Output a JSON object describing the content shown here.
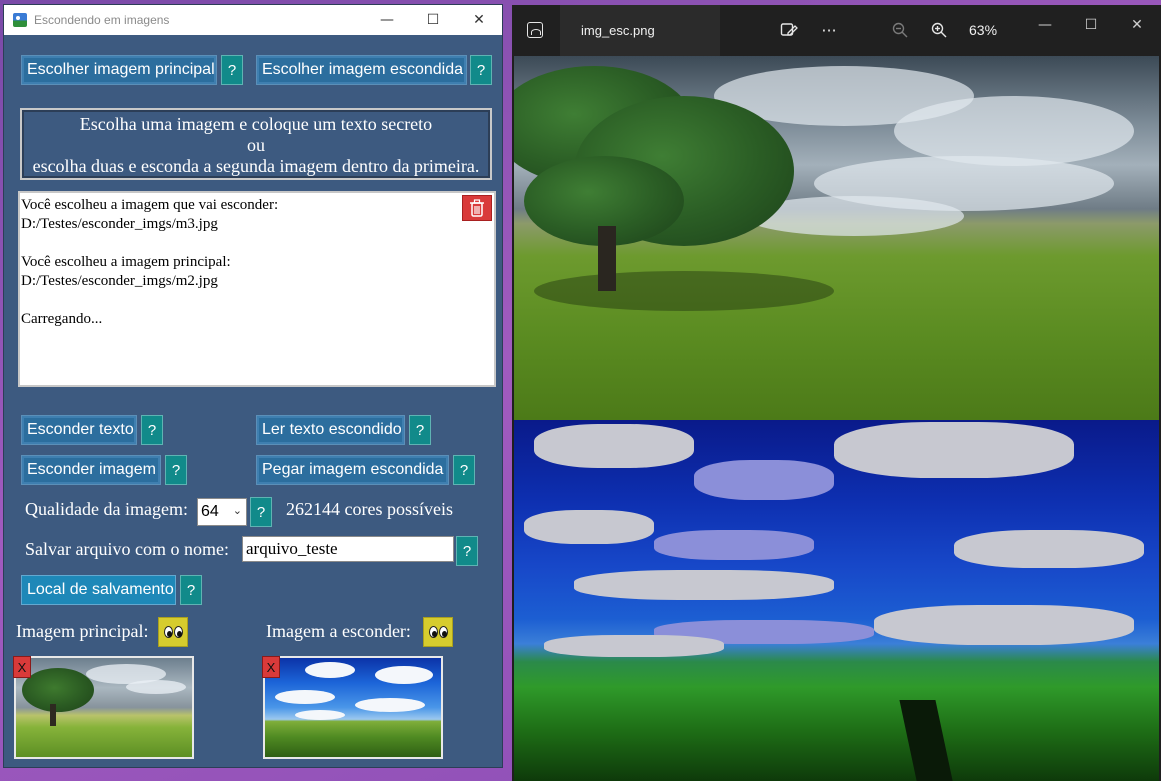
{
  "app_window": {
    "title": "Escondendo em imagens",
    "controls": {
      "minimize": "—",
      "maximize": "☐",
      "close": "✕"
    },
    "buttons": {
      "choose_main": "Escolher imagem principal",
      "choose_hidden": "Escolher imagem escondida",
      "hide_text": "Esconder texto",
      "read_hidden_text": "Ler texto escondido",
      "hide_image": "Esconder imagem",
      "get_hidden_image": "Pegar imagem escondida",
      "save_location": "Local de salvamento",
      "help": "?"
    },
    "instructions": {
      "line1": "Escolha uma imagem e coloque um texto secreto",
      "line2": "ou",
      "line3": "escolha duas e esconda a segunda imagem dentro da primeira."
    },
    "log": {
      "text": "Você escolheu a imagem que vai esconder:\nD:/Testes/esconder_imgs/m3.jpg\n\nVocê escolheu a imagem principal:\nD:/Testes/esconder_imgs/m2.jpg\n\nCarregando..."
    },
    "quality": {
      "label": "Qualidade da imagem:",
      "selected": "64",
      "colors_info": "262144 cores possíveis"
    },
    "save_name": {
      "label": "Salvar arquivo com o nome:",
      "value": "arquivo_teste"
    },
    "previews": {
      "main_label": "Imagem principal:",
      "hide_label": "Imagem a esconder:",
      "remove_label": "X"
    }
  },
  "photo_viewer": {
    "filename": "img_esc.png",
    "zoom": "63%",
    "icons": [
      "gallery-icon",
      "edit-image-icon",
      "more-icon",
      "zoom-out-icon",
      "zoom-in-icon"
    ],
    "controls": {
      "minimize": "—",
      "maximize": "☐",
      "close": "✕"
    },
    "more_glyph": "···"
  },
  "colors": {
    "app_bg": "#3d5a80",
    "button": "#2c6e9e",
    "help_button": "#118a8a",
    "remove_button": "#d93a3a",
    "eyes_button": "#d6cc2e",
    "viewer_bg": "#202020"
  }
}
